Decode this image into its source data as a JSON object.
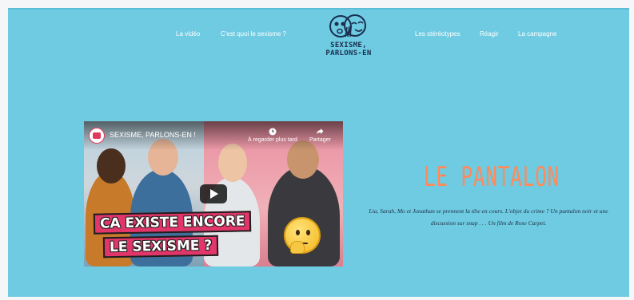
{
  "nav": {
    "left": [
      "La vidéo",
      "C'est quoi le sexisme ?"
    ],
    "right": [
      "Les stéréotypes",
      "Réagir",
      "La campagne"
    ]
  },
  "logo": {
    "text": "SEXISME, PARLONS-EN",
    "icon": "faces-logo-icon"
  },
  "video": {
    "title": "SEXISME, PARLONS-EN !",
    "watch_later": "À regarder plus tard",
    "share": "Partager",
    "banner_line1": "CA EXISTE ENCORE",
    "banner_line2": "LE SEXISME ?",
    "emoji": "thinking-face-icon"
  },
  "content": {
    "heading": "LE PANTALON",
    "description": "Lia, Sarah, Mo et Jonathan se prennent la tête en cours. L'objet du crime ? Un pantalon noir et une discussion sur snap . . . Un film de Rose Carpet."
  },
  "colors": {
    "background": "#6ecbe1",
    "heading": "#ff8a5b",
    "banner": "#e2366b",
    "logo_text": "#1a2d4f"
  }
}
